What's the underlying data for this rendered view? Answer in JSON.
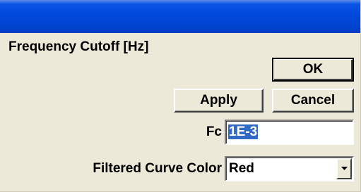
{
  "dialog": {
    "heading": "Frequency Cutoff [Hz]"
  },
  "buttons": {
    "ok_label": "OK",
    "apply_label": "Apply",
    "cancel_label": "Cancel"
  },
  "fields": {
    "fc_label": "Fc",
    "fc_value": "1E-3",
    "curve_color_label": "Filtered Curve Color",
    "curve_color_value": "Red"
  },
  "icons": {
    "dropdown": "chevron-down-icon"
  },
  "colors": {
    "titlebar": "#0046d4",
    "selection_highlight": "#316ac5",
    "dialog_background": "#ece9d8"
  }
}
